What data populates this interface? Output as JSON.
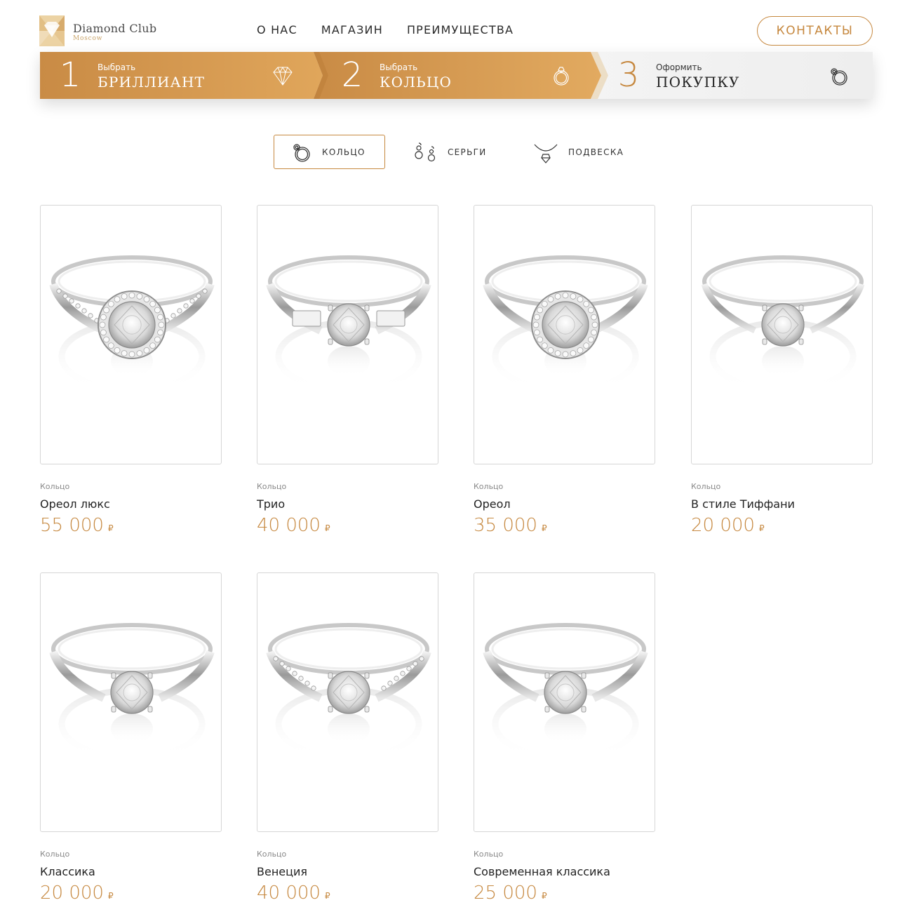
{
  "brand": {
    "name": "Diamond Club",
    "city": "Moscow"
  },
  "nav": {
    "items": [
      "О НАС",
      "МАГАЗИН",
      "ПРЕИМУЩЕСТВА"
    ]
  },
  "contacts_label": "КОНТАКТЫ",
  "steps": [
    {
      "num": "1",
      "small": "Выбрать",
      "big": "БРИЛЛИАНТ",
      "icon": "diamond-icon",
      "active": true
    },
    {
      "num": "2",
      "small": "Выбрать",
      "big": "КОЛЬЦО",
      "icon": "ring-icon",
      "active": true
    },
    {
      "num": "3",
      "small": "Оформить",
      "big": "ПОКУПКУ",
      "icon": "diamond-ring-icon",
      "active": false
    }
  ],
  "categories": [
    {
      "label": "КОЛЬЦО",
      "icon": "ring-icon",
      "active": true
    },
    {
      "label": "СЕРЬГИ",
      "icon": "earrings-icon",
      "active": false
    },
    {
      "label": "ПОДВЕСКА",
      "icon": "pendant-icon",
      "active": false
    }
  ],
  "products": [
    {
      "category": "Кольцо",
      "name": "Ореол люкс",
      "price": "55 000",
      "currency": "₽",
      "style": "halo-pave"
    },
    {
      "category": "Кольцо",
      "name": "Трио",
      "price": "40 000",
      "currency": "₽",
      "style": "trio"
    },
    {
      "category": "Кольцо",
      "name": "Ореол",
      "price": "35 000",
      "currency": "₽",
      "style": "halo"
    },
    {
      "category": "Кольцо",
      "name": "В стиле Тиффани",
      "price": "20 000",
      "currency": "₽",
      "style": "tiffany"
    },
    {
      "category": "Кольцо",
      "name": "Классика",
      "price": "20 000",
      "currency": "₽",
      "style": "classic"
    },
    {
      "category": "Кольцо",
      "name": "Венеция",
      "price": "40 000",
      "currency": "₽",
      "style": "channel"
    },
    {
      "category": "Кольцо",
      "name": "Современная классика",
      "price": "25 000",
      "currency": "₽",
      "style": "modern"
    }
  ],
  "colors": {
    "accent": "#c6883f",
    "step_gradient_from": "#c98b45",
    "step_gradient_to": "#e1a85e"
  }
}
